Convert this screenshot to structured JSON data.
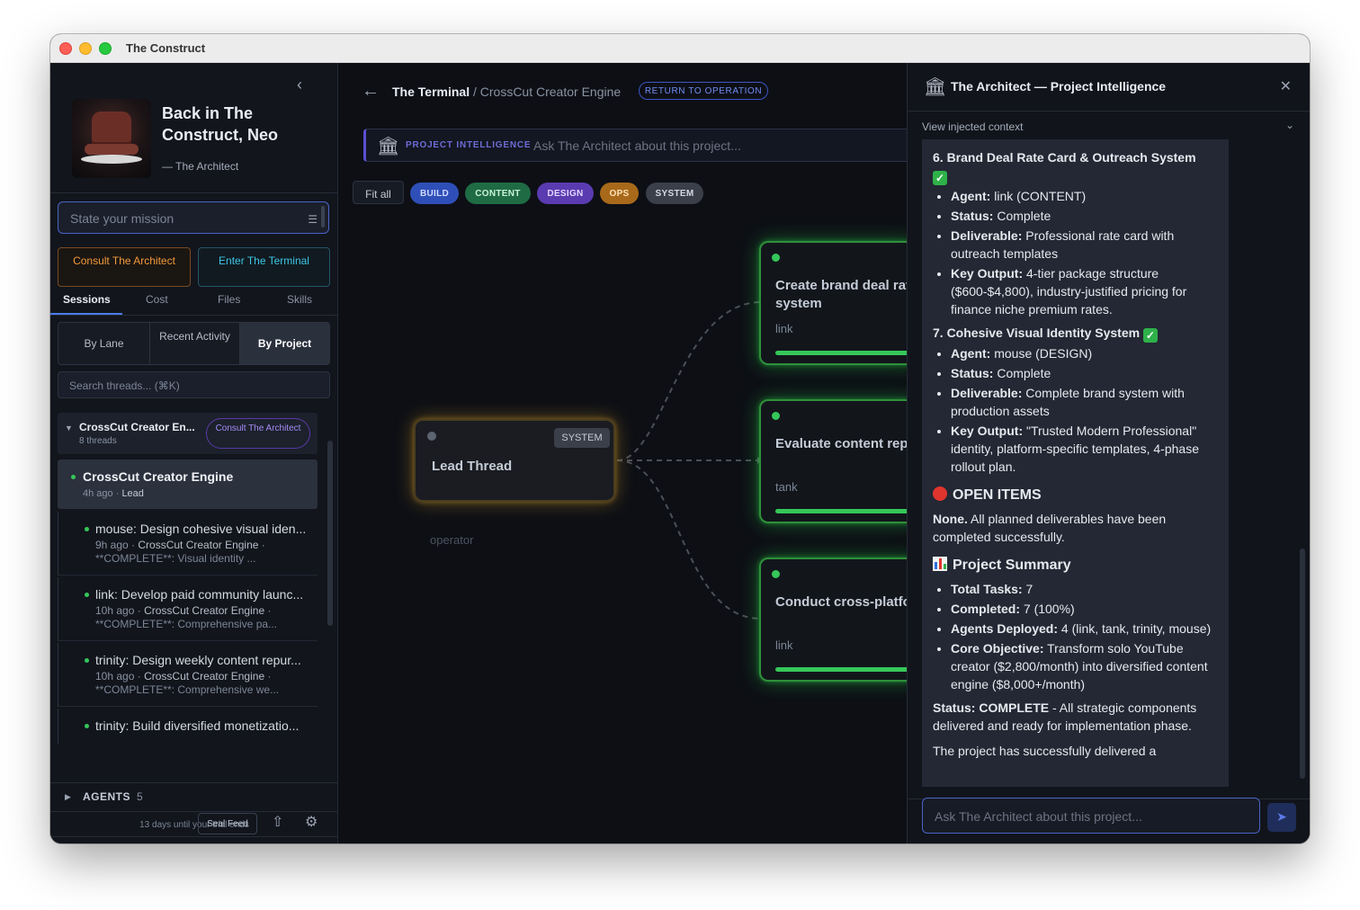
{
  "window": {
    "title": "The Construct"
  },
  "sidebar": {
    "greeting": "Back in The Construct, Neo",
    "greeting_sub": "— The Architect",
    "mission_placeholder": "State your mission",
    "consult_label": "Consult The Architect",
    "terminal_label": "Enter The Terminal",
    "tabs": [
      "Sessions",
      "Cost",
      "Files",
      "Skills"
    ],
    "segments": [
      "By Lane",
      "Recent Activity",
      "By Project"
    ],
    "search_placeholder": "Search threads... (⌘K)",
    "group": {
      "title": "CrossCut Creator En...",
      "count": "8 threads",
      "button": "Consult The Architect"
    },
    "active_thread": {
      "title": "CrossCut Creator Engine",
      "time": "4h ago",
      "role": "Lead"
    },
    "threads": [
      {
        "title": "mouse: Design cohesive visual iden...",
        "time": "9h ago",
        "project": "CrossCut Creator Engine",
        "snippet": "**COMPLETE**: Visual identity ..."
      },
      {
        "title": "link: Develop paid community launc...",
        "time": "10h ago",
        "project": "CrossCut Creator Engine",
        "snippet": "**COMPLETE**: Comprehensive pa..."
      },
      {
        "title": "trinity: Design weekly content repur...",
        "time": "10h ago",
        "project": "CrossCut Creator Engine",
        "snippet": "**COMPLETE**: Comprehensive we..."
      },
      {
        "title": "trinity: Build diversified monetizatio...",
        "time": "",
        "project": "",
        "snippet": ""
      }
    ],
    "agents_label": "AGENTS",
    "agents_count": "5",
    "trial_text": "13 days until your trial ends",
    "seal_feed": "Seal Feed"
  },
  "terminal": {
    "crumb_root": "The Terminal",
    "crumb_sep": "/",
    "crumb_project": "CrossCut Creator Engine",
    "return_label": "RETURN TO OPERATION",
    "pi_label": "PROJECT INTELLIGENCE",
    "pi_placeholder": "Ask The Architect about this project...",
    "fit_all": "Fit all",
    "chips": [
      {
        "label": "BUILD",
        "bg": "#2f4fb8",
        "fg": "#cfd9ff"
      },
      {
        "label": "CONTENT",
        "bg": "#1f6b44",
        "fg": "#c9f2da"
      },
      {
        "label": "DESIGN",
        "bg": "#5b3bb0",
        "fg": "#e2d6ff"
      },
      {
        "label": "OPS",
        "bg": "#a8691a",
        "fg": "#ffe2b8"
      },
      {
        "label": "SYSTEM",
        "bg": "#3a3f4a",
        "fg": "#d4dae3"
      }
    ],
    "lead": {
      "title": "Lead Thread",
      "badge": "SYSTEM",
      "agent": "operator"
    },
    "nodes": [
      {
        "title": "Create brand deal rate card & outreach system",
        "agent": "link"
      },
      {
        "title": "Evaluate content repurposing tool stack",
        "agent": "tank"
      },
      {
        "title": "Conduct cross-platform audit",
        "agent": "link"
      }
    ]
  },
  "panel": {
    "title": "The Architect — Project Intelligence",
    "context_label": "View injected context",
    "ask_placeholder": "Ask The Architect about this project...",
    "message": {
      "item6_title": "6. Brand Deal Rate Card & Outreach System",
      "item6": [
        {
          "k": "Agent:",
          "v": " link (CONTENT)"
        },
        {
          "k": "Status:",
          "v": " Complete"
        },
        {
          "k": "Deliverable:",
          "v": " Professional rate card with outreach templates"
        },
        {
          "k": "Key Output:",
          "v": " 4-tier package structure ($600-$4,800), industry-justified pricing for finance niche premium rates."
        }
      ],
      "item7_title": "7. Cohesive Visual Identity System",
      "item7": [
        {
          "k": "Agent:",
          "v": " mouse (DESIGN)"
        },
        {
          "k": "Status:",
          "v": " Complete"
        },
        {
          "k": "Deliverable:",
          "v": " Complete brand system with production assets"
        },
        {
          "k": "Key Output:",
          "v": " \"Trusted Modern Professional\" identity, platform-specific templates, 4-phase rollout plan."
        }
      ],
      "open_items_title": "OPEN ITEMS",
      "open_items_lead": "None.",
      "open_items_text": " All planned deliverables have been completed successfully.",
      "summary_title": "Project Summary",
      "summary": [
        {
          "k": "Total Tasks:",
          "v": " 7"
        },
        {
          "k": "Completed:",
          "v": " 7 (100%)"
        },
        {
          "k": "Agents Deployed:",
          "v": " 4 (link, tank, trinity, mouse)"
        },
        {
          "k": "Core Objective:",
          "v": " Transform solo YouTube creator ($2,800/month) into diversified content engine ($8,000+/month)"
        }
      ],
      "status_lead": "Status: COMPLETE",
      "status_text": " - All strategic components delivered and ready for implementation phase.",
      "closing": "The project has successfully delivered a"
    }
  }
}
